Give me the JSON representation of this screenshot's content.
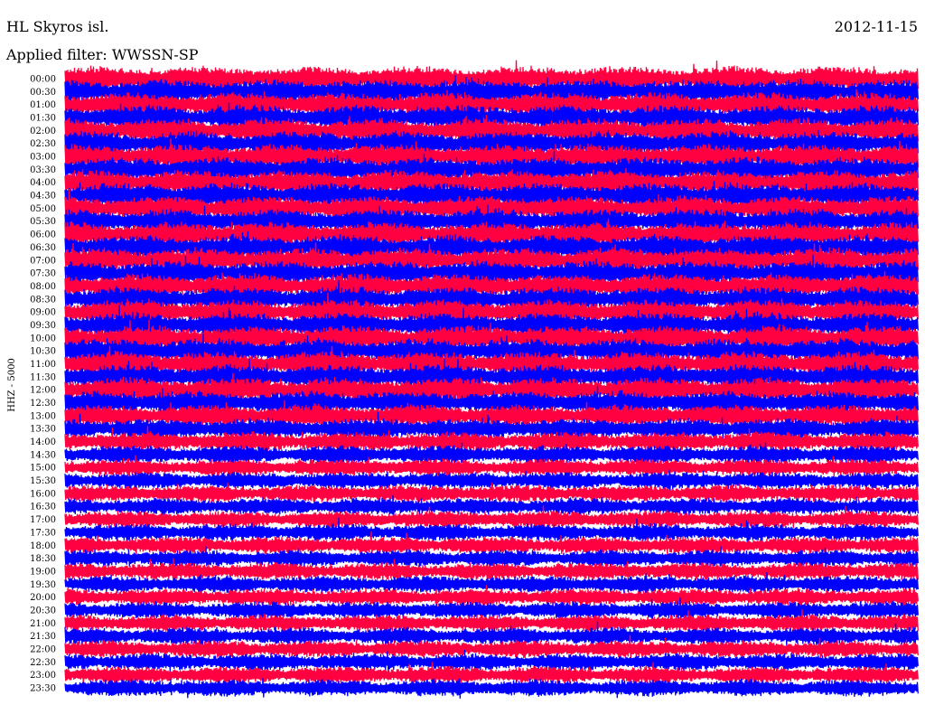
{
  "header": {
    "station": "HL Skyros isl.",
    "date": "2012-11-15",
    "filter": "Applied filter: WWSSN-SP"
  },
  "chart_data": {
    "type": "helicorder",
    "channel_label": "HHZ - 5000",
    "colors": {
      "a": "#0000ff",
      "b": "#ff0040"
    },
    "rows": [
      {
        "label": "00:00",
        "amp": 1.0
      },
      {
        "label": "00:30",
        "amp": 1.0
      },
      {
        "label": "01:00",
        "amp": 1.0
      },
      {
        "label": "01:30",
        "amp": 1.0
      },
      {
        "label": "02:00",
        "amp": 1.0
      },
      {
        "label": "02:30",
        "amp": 1.0
      },
      {
        "label": "03:00",
        "amp": 1.0
      },
      {
        "label": "03:30",
        "amp": 1.0
      },
      {
        "label": "04:00",
        "amp": 1.0
      },
      {
        "label": "04:30",
        "amp": 1.0
      },
      {
        "label": "05:00",
        "amp": 1.0
      },
      {
        "label": "05:30",
        "amp": 1.0
      },
      {
        "label": "06:00",
        "amp": 1.0
      },
      {
        "label": "06:30",
        "amp": 1.0
      },
      {
        "label": "07:00",
        "amp": 1.0
      },
      {
        "label": "07:30",
        "amp": 1.0
      },
      {
        "label": "08:00",
        "amp": 1.0
      },
      {
        "label": "08:30",
        "amp": 1.0
      },
      {
        "label": "09:00",
        "amp": 1.0
      },
      {
        "label": "09:30",
        "amp": 1.0
      },
      {
        "label": "10:00",
        "amp": 1.0
      },
      {
        "label": "10:30",
        "amp": 1.0
      },
      {
        "label": "11:00",
        "amp": 1.0
      },
      {
        "label": "11:30",
        "amp": 1.0
      },
      {
        "label": "12:00",
        "amp": 1.0
      },
      {
        "label": "12:30",
        "amp": 0.95
      },
      {
        "label": "13:00",
        "amp": 0.9
      },
      {
        "label": "13:30",
        "amp": 0.85
      },
      {
        "label": "14:00",
        "amp": 0.8
      },
      {
        "label": "14:30",
        "amp": 0.75
      },
      {
        "label": "15:00",
        "amp": 0.7
      },
      {
        "label": "15:30",
        "amp": 0.7
      },
      {
        "label": "16:00",
        "amp": 0.7
      },
      {
        "label": "16:30",
        "amp": 0.7
      },
      {
        "label": "17:00",
        "amp": 0.7
      },
      {
        "label": "17:30",
        "amp": 0.7
      },
      {
        "label": "18:00",
        "amp": 0.7
      },
      {
        "label": "18:30",
        "amp": 0.7
      },
      {
        "label": "19:00",
        "amp": 0.7
      },
      {
        "label": "19:30",
        "amp": 0.7
      },
      {
        "label": "20:00",
        "amp": 0.7
      },
      {
        "label": "20:30",
        "amp": 0.7
      },
      {
        "label": "21:00",
        "amp": 0.7
      },
      {
        "label": "21:30",
        "amp": 0.7
      },
      {
        "label": "22:00",
        "amp": 0.7
      },
      {
        "label": "22:30",
        "amp": 0.7
      },
      {
        "label": "23:00",
        "amp": 0.7
      },
      {
        "label": "23:30",
        "amp": 0.7
      }
    ]
  }
}
